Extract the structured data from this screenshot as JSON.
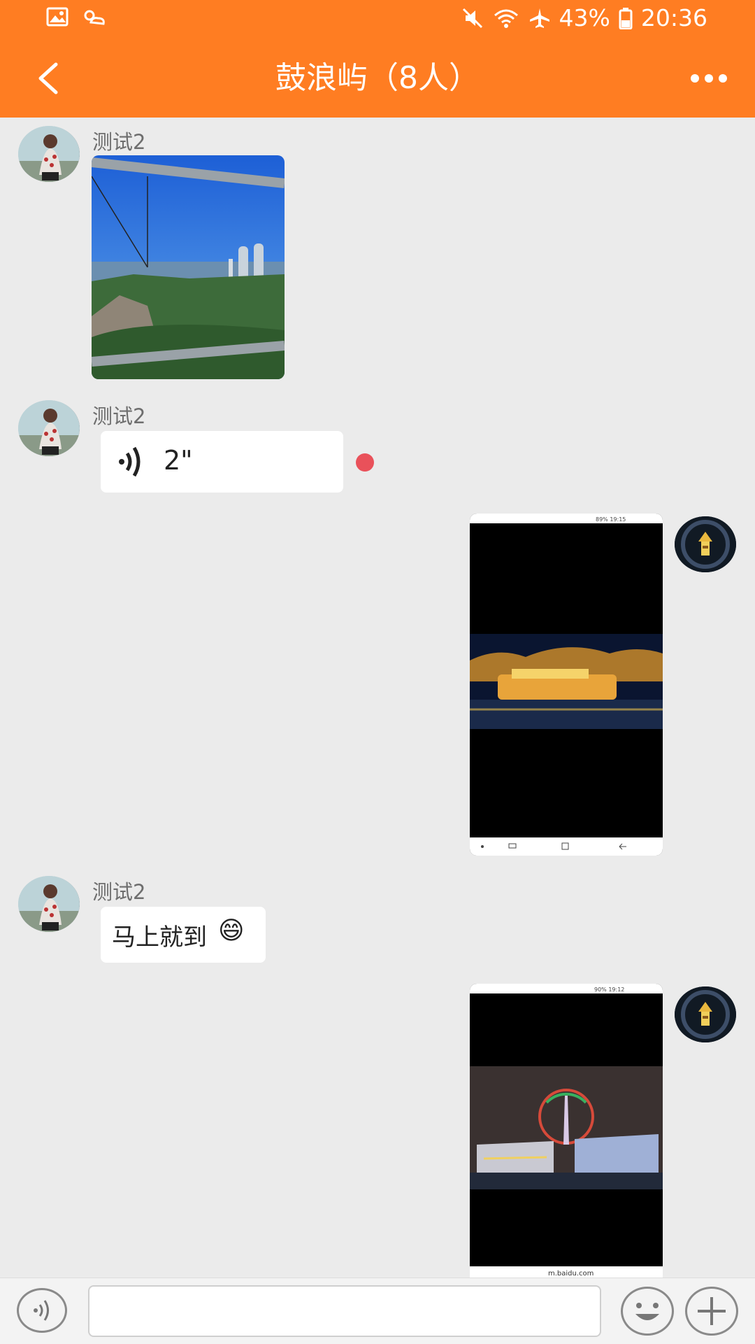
{
  "status_bar": {
    "battery": "43%",
    "time": "20:36",
    "icons": [
      "image-icon",
      "weather-icon",
      "mute-icon",
      "wifi-icon",
      "airplane-icon",
      "battery-icon"
    ]
  },
  "header": {
    "title": "鼓浪屿（8人）",
    "back_icon": "chevron-left-icon",
    "more_icon": "more-dots-icon"
  },
  "messages": [
    {
      "sender": "测试2",
      "type": "image",
      "description_icon": "photo-thumbnail"
    },
    {
      "sender": "测试2",
      "type": "voice",
      "duration": "2\"",
      "unread": true
    },
    {
      "sender": "me",
      "type": "image"
    },
    {
      "sender": "测试2",
      "type": "text",
      "text": "马上就到",
      "emoji": "😄"
    },
    {
      "sender": "me",
      "type": "image"
    }
  ],
  "screenshot_overlays": {
    "msg3_status": "89% 19:15",
    "msg5_status": "90% 19:12",
    "msg5_url": "m.baidu.com"
  },
  "input": {
    "placeholder": ""
  },
  "colors": {
    "accent": "#ff7d22",
    "background": "#ebebeb",
    "unread_dot": "#e9515a"
  }
}
